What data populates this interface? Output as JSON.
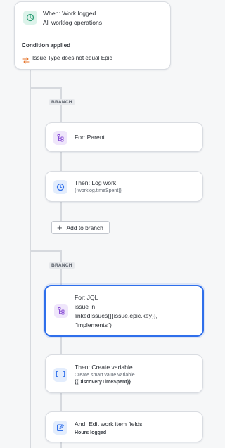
{
  "trigger": {
    "title": "When: Work logged",
    "subtitle": "All worklog operations",
    "condition_heading": "Condition applied",
    "condition_text": "Issue Type does not equal Epic"
  },
  "branches": [
    {
      "badge": "BRANCH",
      "for_label": "For: Parent",
      "actions": [
        {
          "title": "Then: Log work",
          "detail": "{{worklog.timeSpent}}"
        }
      ],
      "add_button": "Add to branch"
    },
    {
      "badge": "BRANCH",
      "for_label": "For: JQL",
      "for_lines": [
        "issue in",
        "linkedIssues({{issue.epic.key}},",
        "\"implements\")"
      ],
      "actions": [
        {
          "title": "Then: Create variable",
          "detail": "Create smart value variable",
          "detail_bold": "{{DiscoveryTimeSpent}}"
        },
        {
          "title": "And: Edit work item fields",
          "detail_bold": "Hours logged"
        }
      ]
    }
  ],
  "colors": {
    "selected_border": "#2f6feb",
    "green_icon": "#2a9d73",
    "purple_icon": "#8a4fd6",
    "blue_icon": "#2f6feb",
    "condition_icon": "#e5732a"
  }
}
